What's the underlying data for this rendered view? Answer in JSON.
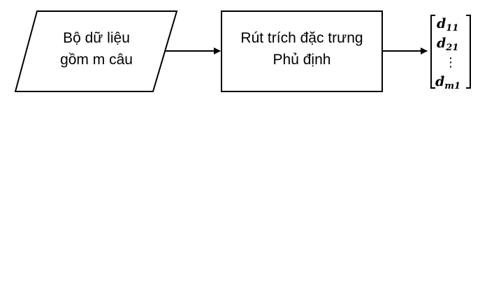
{
  "input_node": {
    "line1": "Bộ dữ liệu",
    "line2": "gồm m câu"
  },
  "process_node": {
    "line1": "Rút trích đặc trưng",
    "line2": "Phủ định"
  },
  "output_vector": {
    "entries": [
      {
        "base": "d",
        "sub": "11"
      },
      {
        "base": "d",
        "sub": "21"
      },
      {
        "base": "⋮",
        "sub": ""
      },
      {
        "base": "d",
        "sub": "m1"
      }
    ]
  }
}
